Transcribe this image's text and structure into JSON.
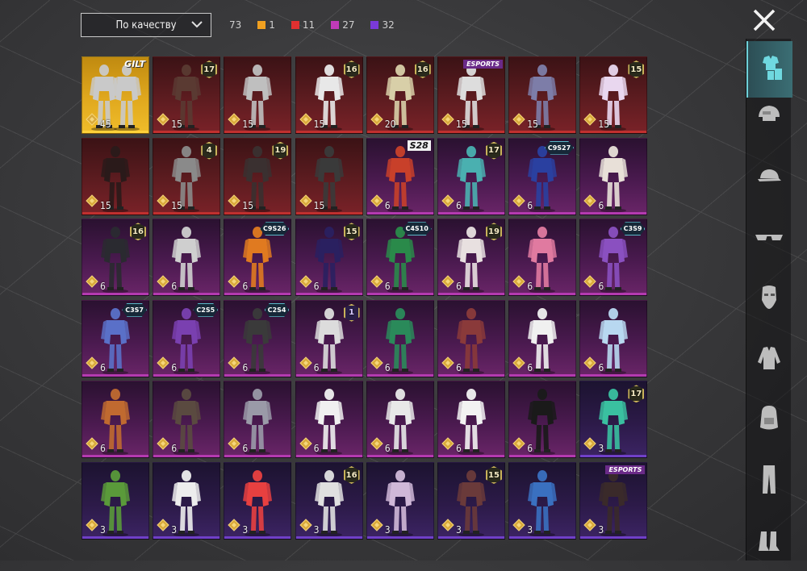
{
  "sort": {
    "label": "По качеству"
  },
  "summary": {
    "total": "73"
  },
  "quality": [
    {
      "color": "#f0a020",
      "count": "1"
    },
    {
      "color": "#e03030",
      "count": "11"
    },
    {
      "color": "#c03ab8",
      "count": "27"
    },
    {
      "color": "#7a3ad8",
      "count": "32"
    }
  ],
  "close": {
    "icon": "close-icon"
  },
  "categories": [
    {
      "icon": "outfit-icon",
      "active": true
    },
    {
      "icon": "helmet-icon",
      "active": false
    },
    {
      "icon": "cap-icon",
      "active": false
    },
    {
      "icon": "glasses-icon",
      "active": false
    },
    {
      "icon": "mask-icon",
      "active": false
    },
    {
      "icon": "jacket-icon",
      "active": false
    },
    {
      "icon": "backpack-icon",
      "active": false
    },
    {
      "icon": "pants-icon",
      "active": false
    },
    {
      "icon": "boots-icon",
      "active": false
    }
  ],
  "items": [
    {
      "rarity": "g",
      "value": "45",
      "badge": "GILT",
      "badgeType": "gilt",
      "figure": "#c9c9c9"
    },
    {
      "rarity": "r",
      "value": "15",
      "badge": "17",
      "badgeType": "num",
      "figure": "#5a3a32"
    },
    {
      "rarity": "r",
      "value": "15",
      "badge": "",
      "badgeType": "",
      "figure": "#bfbfbf"
    },
    {
      "rarity": "r",
      "value": "15",
      "badge": "16",
      "badgeType": "num",
      "figure": "#e8e8e8"
    },
    {
      "rarity": "r",
      "value": "20",
      "badge": "16",
      "badgeType": "num",
      "figure": "#d8cfa8"
    },
    {
      "rarity": "r",
      "value": "15",
      "badge": "ESPORTS",
      "badgeType": "esports",
      "figure": "#dddddd"
    },
    {
      "rarity": "r",
      "value": "15",
      "badge": "",
      "badgeType": "",
      "figure": "#7d7da8"
    },
    {
      "rarity": "r",
      "value": "15",
      "badge": "15",
      "badgeType": "num",
      "figure": "#e9d7ef"
    },
    {
      "rarity": "r",
      "value": "15",
      "badge": "",
      "badgeType": "",
      "figure": "#2a1a1a"
    },
    {
      "rarity": "r",
      "value": "15",
      "badge": "4",
      "badgeType": "num",
      "figure": "#8a8a8a"
    },
    {
      "rarity": "r",
      "value": "15",
      "badge": "19",
      "badgeType": "num",
      "figure": "#3a3030"
    },
    {
      "rarity": "r",
      "value": "15",
      "badge": "",
      "badgeType": "",
      "figure": "#3a3a3a"
    },
    {
      "rarity": "m",
      "value": "6",
      "badge": "S28",
      "badgeType": "s",
      "figure": "#c8402a"
    },
    {
      "rarity": "m",
      "value": "6",
      "badge": "17",
      "badgeType": "num",
      "figure": "#4ab0b0"
    },
    {
      "rarity": "m",
      "value": "6",
      "badge": "C9S27",
      "badgeType": "season",
      "figure": "#2a40a0"
    },
    {
      "rarity": "m",
      "value": "6",
      "badge": "",
      "badgeType": "",
      "figure": "#e8e0d8"
    },
    {
      "rarity": "m",
      "value": "6",
      "badge": "16",
      "badgeType": "num",
      "figure": "#2a2a30"
    },
    {
      "rarity": "m",
      "value": "6",
      "badge": "",
      "badgeType": "",
      "figure": "#cfcfcf"
    },
    {
      "rarity": "m",
      "value": "6",
      "badge": "C9S26",
      "badgeType": "season",
      "figure": "#e07a20"
    },
    {
      "rarity": "m",
      "value": "6",
      "badge": "15",
      "badgeType": "num",
      "figure": "#2a2060"
    },
    {
      "rarity": "m",
      "value": "6",
      "badge": "C4S10",
      "badgeType": "season",
      "figure": "#2a8a4a"
    },
    {
      "rarity": "m",
      "value": "6",
      "badge": "19",
      "badgeType": "num",
      "figure": "#e8e0e0"
    },
    {
      "rarity": "m",
      "value": "6",
      "badge": "",
      "badgeType": "",
      "figure": "#e07aa0"
    },
    {
      "rarity": "m",
      "value": "6",
      "badge": "C3S9",
      "badgeType": "season",
      "figure": "#8a50c0"
    },
    {
      "rarity": "m",
      "value": "6",
      "badge": "C3S7",
      "badgeType": "season",
      "figure": "#5a70c8"
    },
    {
      "rarity": "m",
      "value": "6",
      "badge": "C2S5",
      "badgeType": "season",
      "figure": "#7a40b0"
    },
    {
      "rarity": "m",
      "value": "6",
      "badge": "C2S4",
      "badgeType": "season",
      "figure": "#3a3a3a"
    },
    {
      "rarity": "m",
      "value": "6",
      "badge": "1",
      "badgeType": "num-violet",
      "figure": "#dcdcdc"
    },
    {
      "rarity": "m",
      "value": "6",
      "badge": "",
      "badgeType": "",
      "figure": "#2a8a5a"
    },
    {
      "rarity": "m",
      "value": "6",
      "badge": "",
      "badgeType": "",
      "figure": "#8a3a3a"
    },
    {
      "rarity": "m",
      "value": "6",
      "badge": "",
      "badgeType": "",
      "figure": "#f0f0f0"
    },
    {
      "rarity": "m",
      "value": "6",
      "badge": "",
      "badgeType": "",
      "figure": "#b8d8f0"
    },
    {
      "rarity": "m",
      "value": "6",
      "badge": "",
      "badgeType": "",
      "figure": "#c06a30"
    },
    {
      "rarity": "m",
      "value": "6",
      "badge": "",
      "badgeType": "",
      "figure": "#5a4a40"
    },
    {
      "rarity": "m",
      "value": "6",
      "badge": "",
      "badgeType": "",
      "figure": "#9a9aa8"
    },
    {
      "rarity": "m",
      "value": "6",
      "badge": "",
      "badgeType": "",
      "figure": "#f0f0f0"
    },
    {
      "rarity": "m",
      "value": "6",
      "badge": "",
      "badgeType": "",
      "figure": "#e8e8e8"
    },
    {
      "rarity": "m",
      "value": "6",
      "badge": "",
      "badgeType": "",
      "figure": "#f2f2f2"
    },
    {
      "rarity": "m",
      "value": "6",
      "badge": "",
      "badgeType": "",
      "figure": "#1a1a1a"
    },
    {
      "rarity": "v",
      "value": "3",
      "badge": "17",
      "badgeType": "num",
      "figure": "#3ac0a0"
    },
    {
      "rarity": "v",
      "value": "3",
      "badge": "",
      "badgeType": "",
      "figure": "#5a9a3a"
    },
    {
      "rarity": "v",
      "value": "3",
      "badge": "",
      "badgeType": "",
      "figure": "#ededed"
    },
    {
      "rarity": "v",
      "value": "3",
      "badge": "",
      "badgeType": "",
      "figure": "#e84040"
    },
    {
      "rarity": "v",
      "value": "3",
      "badge": "16",
      "badgeType": "num",
      "figure": "#e0e0e0"
    },
    {
      "rarity": "v",
      "value": "3",
      "badge": "",
      "badgeType": "",
      "figure": "#d0b8d8"
    },
    {
      "rarity": "v",
      "value": "3",
      "badge": "15",
      "badgeType": "num",
      "figure": "#6a3a3a"
    },
    {
      "rarity": "v",
      "value": "3",
      "badge": "",
      "badgeType": "",
      "figure": "#3a70c0"
    },
    {
      "rarity": "v",
      "value": "3",
      "badge": "ESPORTS",
      "badgeType": "esports",
      "figure": "#3a2a2a"
    }
  ]
}
